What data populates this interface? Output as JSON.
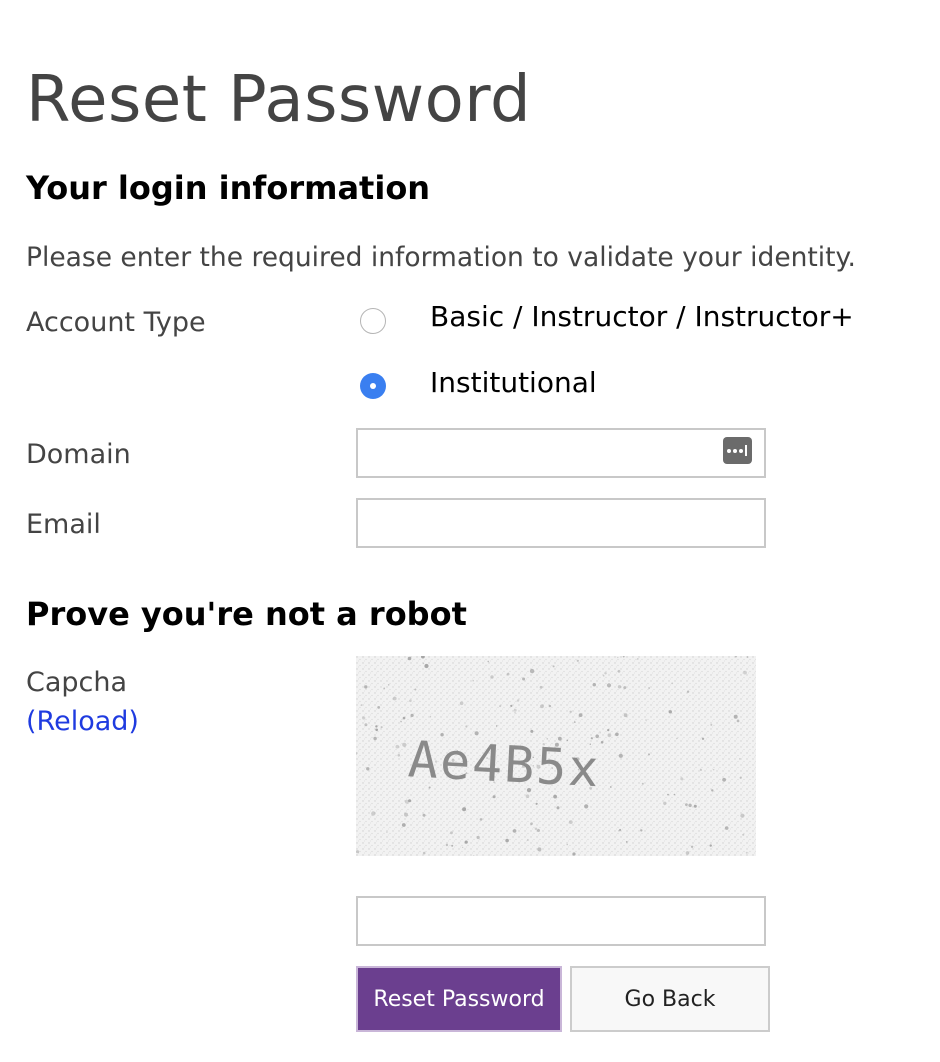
{
  "page": {
    "title": "Reset Password"
  },
  "login_section": {
    "heading": "Your login information",
    "intro": "Please enter the required information to validate your identity.",
    "account_type": {
      "label": "Account Type",
      "options": [
        {
          "label": "Basic / Instructor / Instructor+",
          "selected": false
        },
        {
          "label": "Institutional",
          "selected": true
        }
      ]
    },
    "domain": {
      "label": "Domain",
      "value": ""
    },
    "email": {
      "label": "Email",
      "value": ""
    }
  },
  "robot_section": {
    "heading": "Prove you're not a robot",
    "captcha_label": "Capcha",
    "reload_label": "(Reload)",
    "captcha_text": "Ae4B5x",
    "captcha_answer": ""
  },
  "buttons": {
    "reset_label": "Reset Password",
    "back_label": "Go Back"
  },
  "colors": {
    "primary_button": "#6b3f8f",
    "radio_selected": "#3a7ff0",
    "link": "#1f3be0"
  },
  "icons": {
    "domain_field_icon": "password-manager-icon"
  }
}
